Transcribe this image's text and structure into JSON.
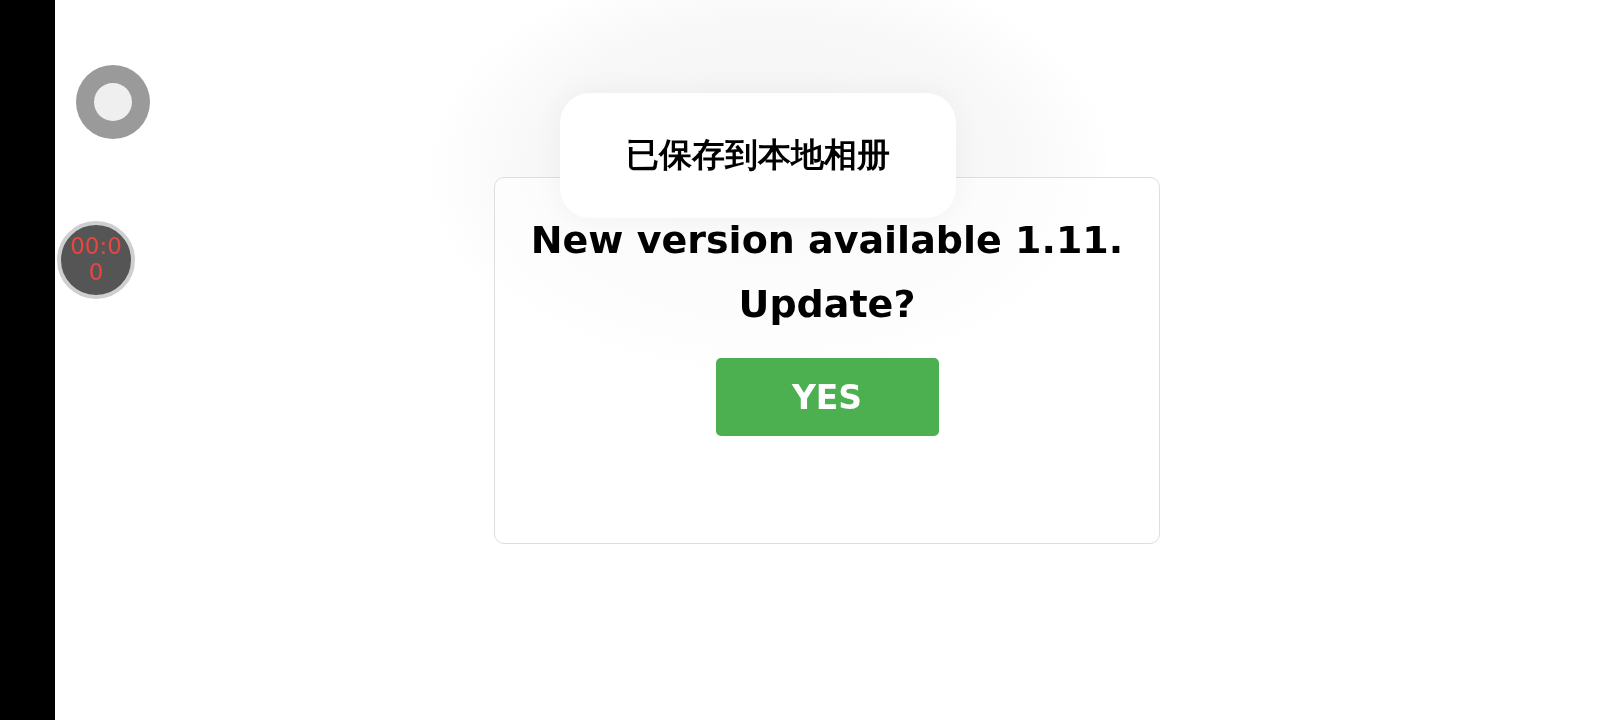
{
  "toast": {
    "text": "已保存到本地相册"
  },
  "dialog": {
    "message": "New version available 1.11. Update?",
    "button": "YES"
  },
  "recorder": {
    "timer": "00:00"
  }
}
